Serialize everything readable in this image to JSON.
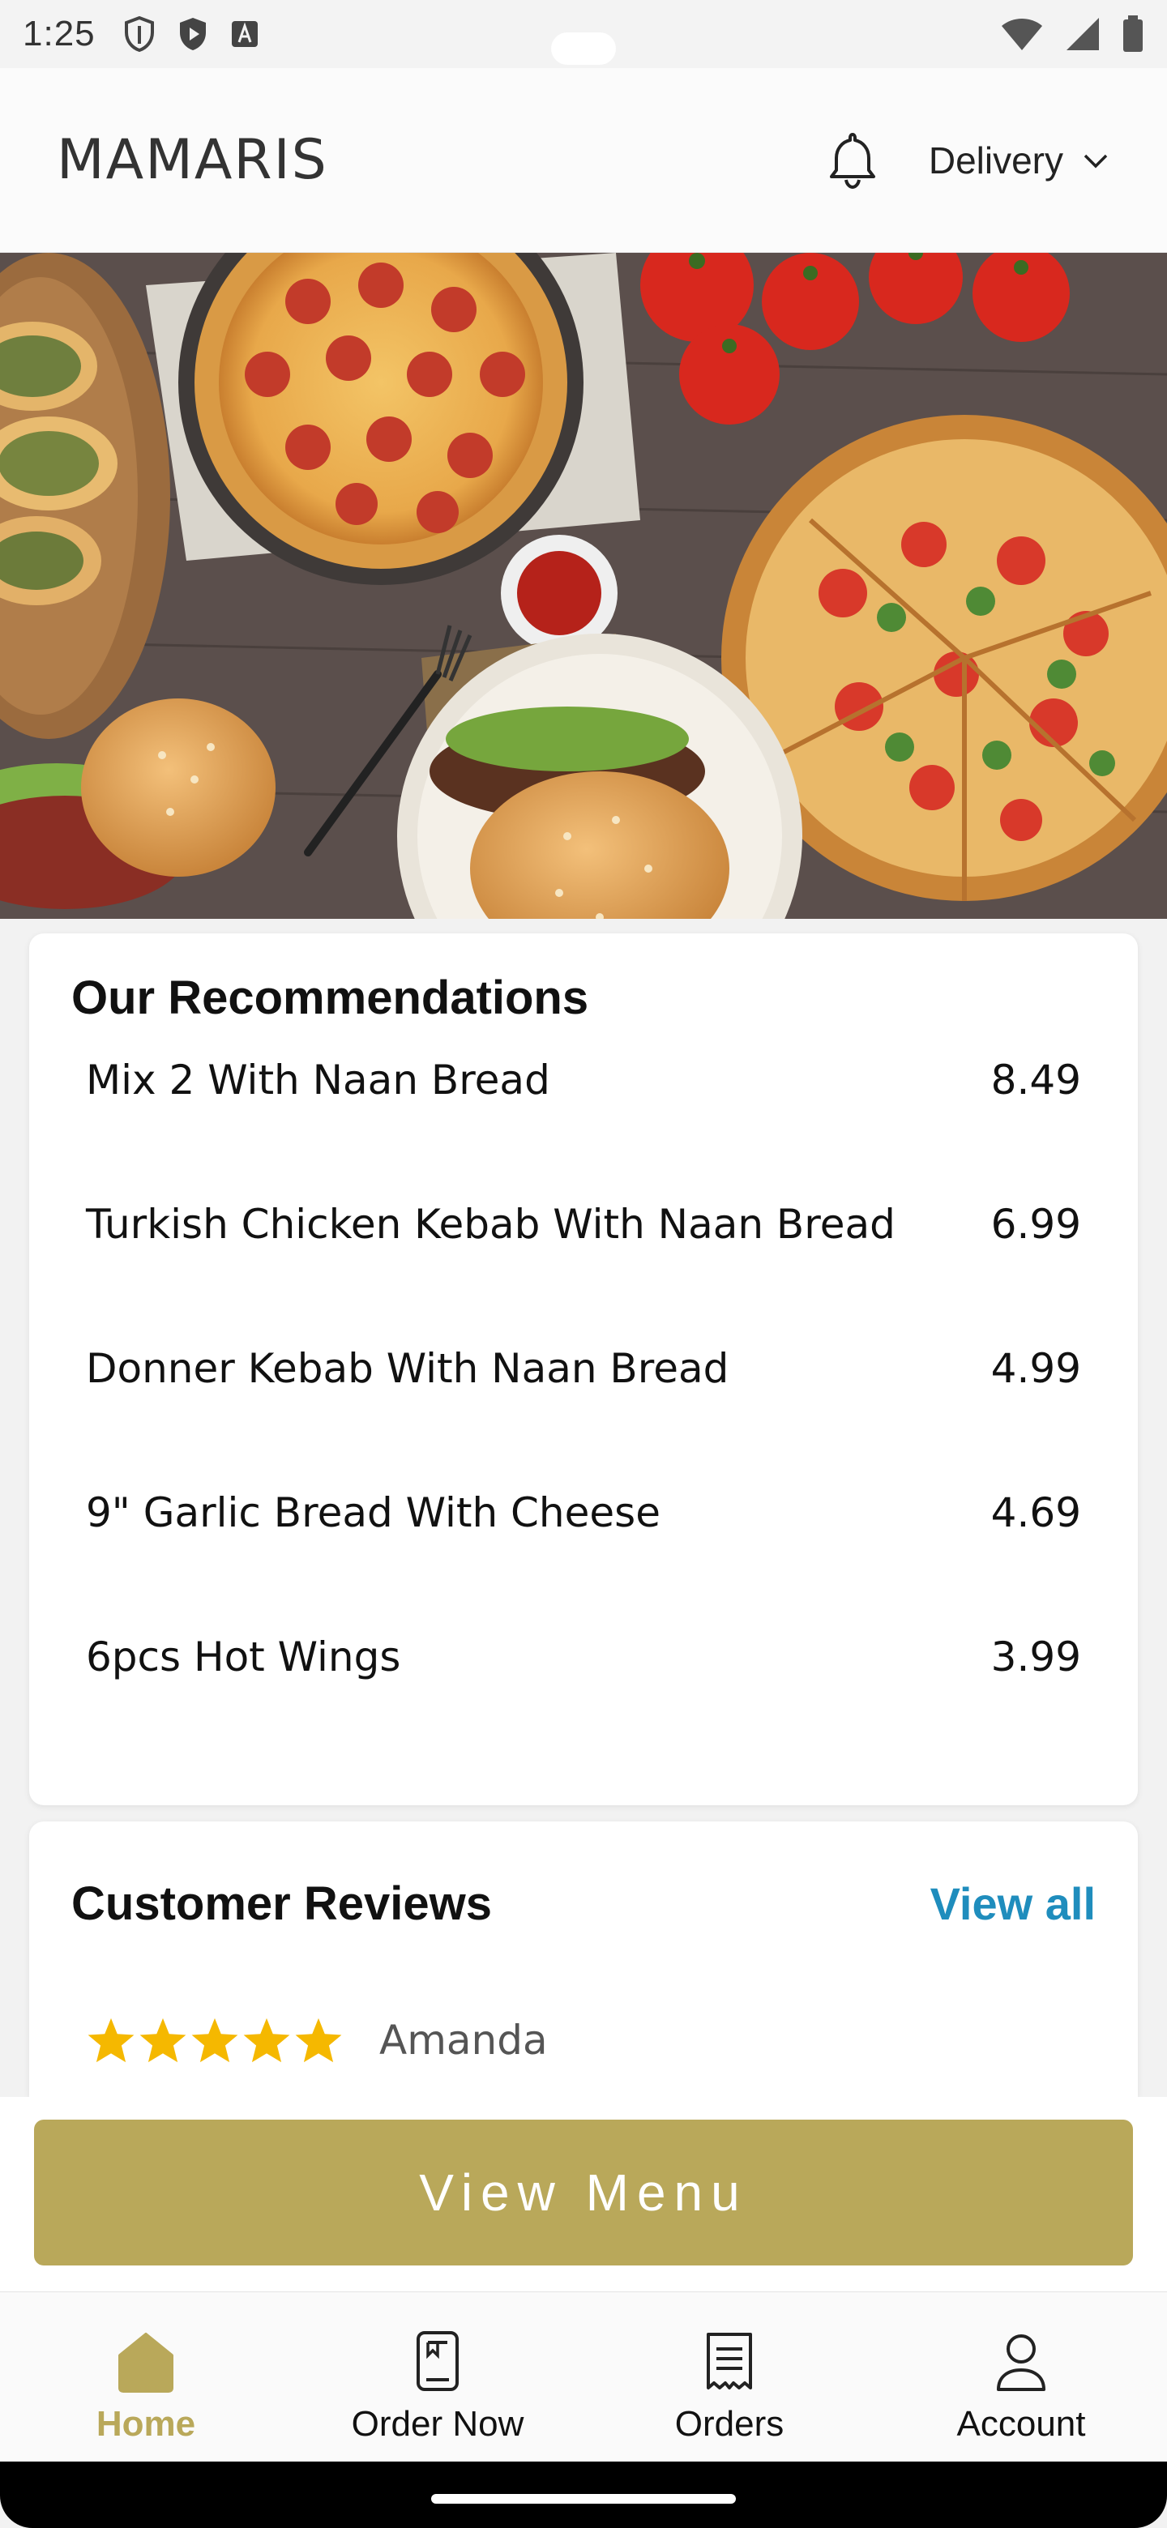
{
  "status_bar": {
    "time": "1:25",
    "left_icons": [
      "shield-icon",
      "play-protect-icon",
      "font-icon"
    ],
    "right_icons": [
      "wifi-icon",
      "signal-icon",
      "battery-icon"
    ]
  },
  "header": {
    "brand": "MAMARIS",
    "bell_icon": "bell-icon",
    "mode": "Delivery"
  },
  "recommendations": {
    "title": "Our Recommendations",
    "items": [
      {
        "name": "Mix 2 With Naan Bread",
        "price": "8.49"
      },
      {
        "name": "Turkish Chicken Kebab With Naan Bread",
        "price": "6.99"
      },
      {
        "name": "Donner Kebab With Naan Bread",
        "price": "4.99"
      },
      {
        "name": "9\" Garlic Bread With Cheese",
        "price": "4.69"
      },
      {
        "name": "6pcs Hot Wings",
        "price": "3.99"
      }
    ]
  },
  "reviews": {
    "title": "Customer Reviews",
    "view_all": "View all",
    "items": [
      {
        "rating": 5,
        "author": "Amanda"
      }
    ]
  },
  "view_menu_button": "View Menu",
  "bottom_nav": [
    {
      "label": "Home",
      "icon": "home-icon",
      "active": true
    },
    {
      "label": "Order Now",
      "icon": "order-icon",
      "active": false
    },
    {
      "label": "Orders",
      "icon": "receipt-icon",
      "active": false
    },
    {
      "label": "Account",
      "icon": "user-icon",
      "active": false
    }
  ],
  "colors": {
    "accent": "#b9a85a",
    "link": "#1f8dbd",
    "star": "#f5b800"
  }
}
